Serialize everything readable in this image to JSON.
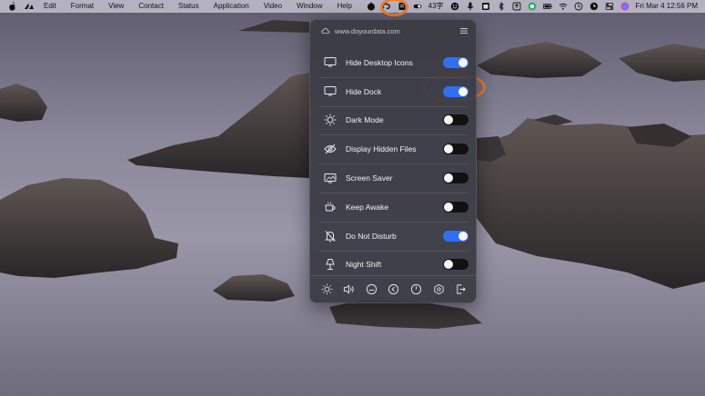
{
  "menubar": {
    "apple_icon": "apple-logo-icon",
    "app_icon": "app-icon",
    "menus": [
      "Edit",
      "Format",
      "View",
      "Contact",
      "Status",
      "Application",
      "Video",
      "Window",
      "Help"
    ],
    "status_items": [
      {
        "name": "apple-music-icon"
      },
      {
        "name": "creative-cloud-icon"
      },
      {
        "name": "notes-icon"
      },
      {
        "name": "one-switch-icon"
      },
      {
        "name": "input-method-icon",
        "text": "43字"
      },
      {
        "name": "smiley-icon"
      },
      {
        "name": "microphone-icon"
      },
      {
        "name": "window-icon"
      },
      {
        "name": "bluetooth-icon"
      },
      {
        "name": "upload-icon"
      },
      {
        "name": "green-circle-icon"
      },
      {
        "name": "battery-icon"
      },
      {
        "name": "wifi-icon"
      },
      {
        "name": "time-machine-icon"
      },
      {
        "name": "clock-icon"
      },
      {
        "name": "control-center-icon"
      },
      {
        "name": "siri-icon"
      }
    ],
    "datetime": "Fri Mar 4  12:56 PM"
  },
  "panel": {
    "site": "www.doyourdata.com",
    "items": [
      {
        "label": "Hide Desktop Icons",
        "icon": "monitor-icon",
        "on": true
      },
      {
        "label": "Hide Dock",
        "icon": "monitor-icon",
        "on": true
      },
      {
        "label": "Dark Mode",
        "icon": "sun-icon",
        "on": false
      },
      {
        "label": "Display Hidden Files",
        "icon": "eye-slash-icon",
        "on": false
      },
      {
        "label": "Screen Saver",
        "icon": "screen-saver-icon",
        "on": false
      },
      {
        "label": "Keep Awake",
        "icon": "coffee-cup-icon",
        "on": false
      },
      {
        "label": "Do Not Disturb",
        "icon": "bell-slash-icon",
        "on": true
      },
      {
        "label": "Night Shift",
        "icon": "lamp-icon",
        "on": false
      }
    ],
    "footer_buttons": [
      "brightness-icon",
      "volume-icon",
      "sleep-icon",
      "back-icon",
      "power-icon",
      "settings-icon",
      "quit-icon"
    ]
  },
  "colors": {
    "toggle_on": "#2f6ff0",
    "toggle_off": "#111114",
    "highlight": "#f07a2c"
  }
}
